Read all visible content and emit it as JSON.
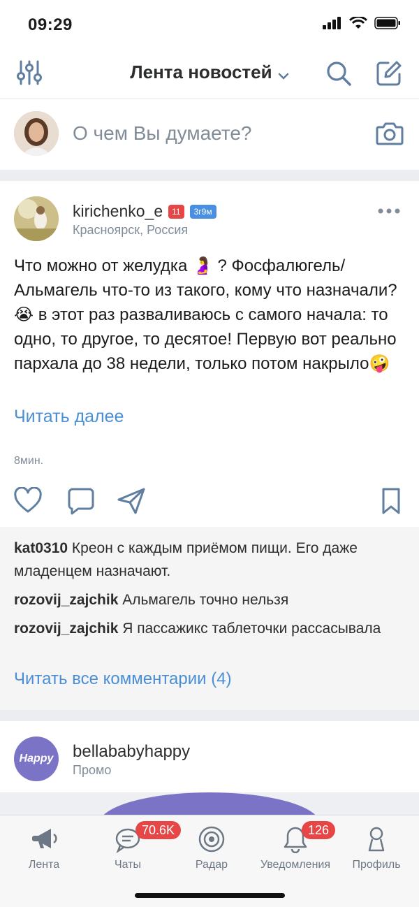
{
  "status_bar": {
    "time": "09:29"
  },
  "header": {
    "title": "Лента новостей"
  },
  "composer": {
    "placeholder": "О чем Вы думаете?"
  },
  "post": {
    "author": "kirichenko_e",
    "level_badge": "11",
    "pregnancy_badge": "3г9м",
    "location": "Красноярск, Россия",
    "text": "Что можно от желудка 🤰 ? Фосфалюгель/ Альмагель что-то из такого, кому что назначали?😭 в этот раз разваливаюсь с самого начала: то одно, то другое, то десятое! Первую вот реально пархала до 38 недели, только потом накрыло🤪",
    "read_more": "Читать далее",
    "time": "8мин."
  },
  "comments": {
    "items": [
      {
        "user": "kat0310",
        "text": "Креон с каждым приёмом пищи.  Его даже младенцем назначают."
      },
      {
        "user": "rozovij_zajchik",
        "text": "Альмагель точно нельзя"
      },
      {
        "user": "rozovij_zajchik",
        "text": "Я пассажикс таблеточки рассасывала"
      }
    ],
    "read_all": "Читать все комментарии (4)"
  },
  "promo": {
    "name": "bellababyhappy",
    "tag": "Промо",
    "avatar_text": "Happy"
  },
  "tabbar": {
    "tabs": [
      {
        "label": "Лента",
        "icon": "megaphone-icon"
      },
      {
        "label": "Чаты",
        "icon": "chat-icon",
        "counter": "70.6K"
      },
      {
        "label": "Радар",
        "icon": "radar-icon"
      },
      {
        "label": "Уведомления",
        "icon": "bell-icon",
        "counter": "126"
      },
      {
        "label": "Профиль",
        "icon": "profile-icon"
      }
    ]
  },
  "colors": {
    "accent": "#4a8fd6",
    "counter": "#e64646",
    "promo": "#7b74c6"
  }
}
